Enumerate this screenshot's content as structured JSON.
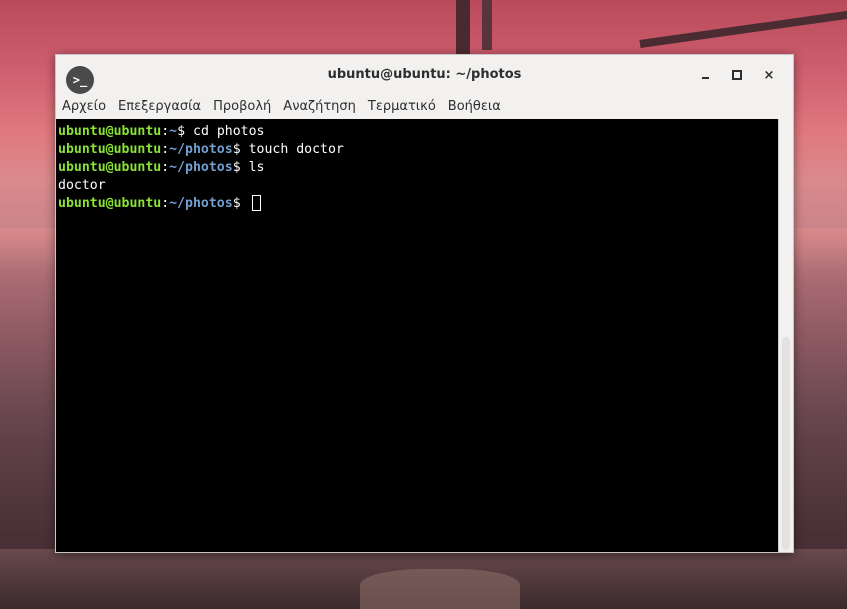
{
  "window": {
    "title": "ubuntu@ubuntu: ~/photos",
    "app_icon_glyph": ">_",
    "controls": {
      "close_glyph": "×"
    }
  },
  "menubar": {
    "items": [
      {
        "label": "Αρχείο"
      },
      {
        "label": "Επεξεργασία"
      },
      {
        "label": "Προβολή"
      },
      {
        "label": "Αναζήτηση"
      },
      {
        "label": "Τερματικό"
      },
      {
        "label": "Βοήθεια"
      }
    ]
  },
  "terminal": {
    "lines": [
      {
        "user": "ubuntu@ubuntu",
        "colon": ":",
        "path": "~",
        "prompt": "$ ",
        "command": "cd photos"
      },
      {
        "user": "ubuntu@ubuntu",
        "colon": ":",
        "path": "~/photos",
        "prompt": "$ ",
        "command": "touch doctor"
      },
      {
        "user": "ubuntu@ubuntu",
        "colon": ":",
        "path": "~/photos",
        "prompt": "$ ",
        "command": "ls"
      },
      {
        "output": "doctor"
      },
      {
        "user": "ubuntu@ubuntu",
        "colon": ":",
        "path": "~/photos",
        "prompt": "$ ",
        "command": ""
      }
    ]
  },
  "colors": {
    "user_prompt": "#8ae234",
    "path_prompt": "#729fcf",
    "terminal_background": "#000000",
    "terminal_text": "#ffffff"
  }
}
